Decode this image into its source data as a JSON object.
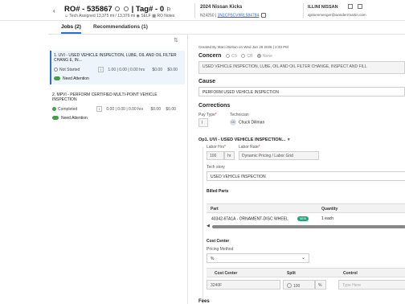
{
  "header": {
    "ro_title": "RO# - 535867",
    "tag": "| Tag# - 0",
    "tech_assigned": "Tech Assigned",
    "miles": "13,375 mi / 13,376 mi",
    "self": "SELF",
    "ro_notes": "RO Notes",
    "vehicle": "2024 Nissan Kicks",
    "vehicle_id": "N24250 |",
    "vin": "3N1CP5CV9RL584784",
    "dealer": "ILLINI NISSAN",
    "email": "ajeisenmenger@wonderrmartin.com"
  },
  "tabs": {
    "jobs": "Jobs (2)",
    "recommendations": "Recommendations (1)"
  },
  "jobs": [
    {
      "title": "1. UVI - USED VEHICLE INSPECTION, LUBE, OIL AND OIL FILTER CHANG E, IN...",
      "status": "Not Started",
      "info": "i",
      "hours_sold": "1.00",
      "hours_a": "0.00",
      "hours_b": "0.00 hrs",
      "price_a": "$0.00",
      "price_b": "$0.00",
      "attention": "Need Attention"
    },
    {
      "title": "2. MPVI - PERFORM CERTIFIED MULTI-POINT VEHICLE INSPECTION",
      "status": "Completed",
      "info": "i",
      "hours_a": "0.00",
      "hours_b": "0.00 hrs",
      "price_a": "$0.00",
      "price_b": "$0.00",
      "attention": "Need Attention"
    }
  ],
  "detail": {
    "created": "Created By Marci Belton on Wed Jan 28 2026 | 2:33 PM",
    "concern_label": "Concern",
    "concern_options": [
      "CS",
      "CR",
      "None"
    ],
    "concern_text": "USED VEHICLE INSPECTION, LUBE, OIL AND OIL FILTER CHANGE, INSPECT AND FILL",
    "cause_label": "Cause",
    "cause_text": "PERFORM USED VEHICLE INSPECTION",
    "corrections_label": "Corrections",
    "pay_type_label": "Pay Type",
    "pay_type_value": "I",
    "technician_label": "Technician",
    "technician_initials": "CD",
    "technician_name": "Chuck Dillman",
    "op_title": "Op1. UVI - USED VEHICLE INSPECTION...",
    "labor_hrs_label": "Labor Hrs",
    "labor_hrs_value": "100",
    "labor_hrs_unit": "hr",
    "labor_rate_label": "Labor Rate",
    "labor_rate_value": "Dynamic Pricing / Labor Grid",
    "tech_story_label": "Tech story",
    "tech_story_value": "USED VEHICLE INSPECTION",
    "billed_parts_label": "Billed Parts",
    "parts_headers": [
      "Part",
      "Quantity"
    ],
    "part_name": "40342-6TA1A - ORNAMENT-DISC WHEEL",
    "part_tag": "NEW",
    "part_qty": "1 each",
    "cost_center_label": "Cost Center",
    "pricing_method_label": "Pricing Method",
    "pricing_method_value": "%",
    "cc_headers": [
      "Cost Center",
      "Split",
      "Control"
    ],
    "cc_value": "3240F",
    "split_value": "100",
    "split_unit": "%",
    "control_placeholder": "Type Here",
    "fees_label": "Fees"
  }
}
